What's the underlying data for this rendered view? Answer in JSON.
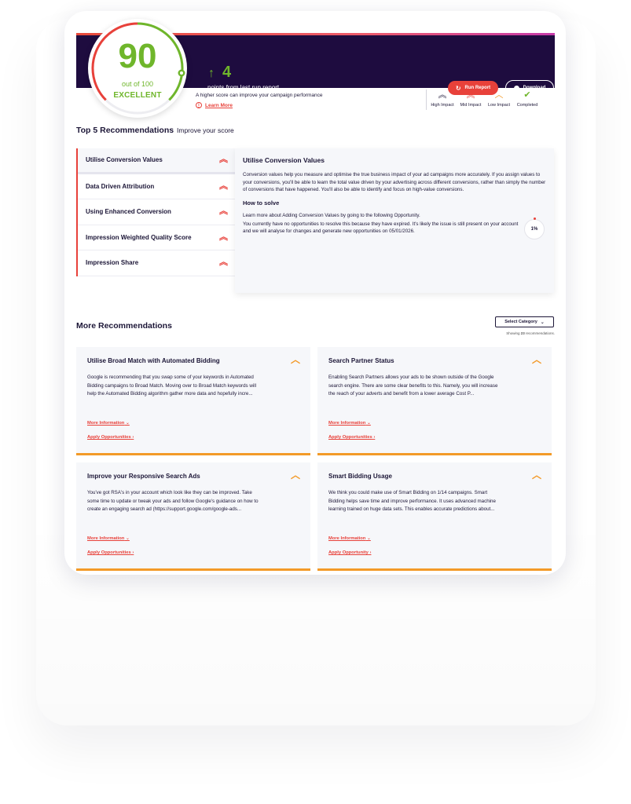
{
  "score": {
    "value": "90",
    "out_of": "out of 100",
    "grade": "EXCELLENT",
    "level_fraction": 0.9,
    "colors": {
      "good": "#6fb62b",
      "bad": "#e8413a"
    }
  },
  "delta": {
    "value": "4",
    "label": "points from last run report",
    "report_date": "Report last run 20/08/2023"
  },
  "header": {
    "run_report": "Run Report",
    "download": "Download",
    "background": "#1e0c3f"
  },
  "hint": {
    "text": "A higher score can improve your campaign performance",
    "learn_more": "Learn More"
  },
  "legend": [
    {
      "icon": "high-impact-icon",
      "label": "High Impact"
    },
    {
      "icon": "mid-impact-icon",
      "label": "Mid Impact"
    },
    {
      "icon": "low-impact-icon",
      "label": "Low Impact"
    },
    {
      "icon": "completed-icon",
      "label": "Completed"
    }
  ],
  "top5": {
    "title": "Top 5 Recommendations",
    "subtitle": "Improve your score",
    "items": [
      {
        "label": "Utilise Conversion Values"
      },
      {
        "label": "Data Driven Attribution"
      },
      {
        "label": "Using Enhanced Conversion"
      },
      {
        "label": "Impression Weighted Quality Score"
      },
      {
        "label": "Impression Share"
      }
    ],
    "detail": {
      "title": "Utilise Conversion Values",
      "body": "Conversion values help you measure and optimise the true business impact of your ad campaigns more accurately. If you assign values to your conversions, you'll be able to learn the total value driven by your advertising across different conversions, rather than simply the number of conversions that have happened. You'll also be able to identify and focus on high-value conversions.",
      "how_title": "How to solve",
      "learn_line": "Learn more about Adding Conversion Values by going to the following Opportunity.",
      "note": "You currently have no opportunities to resolve this because they have expired. It's likely the issue is still present on your account and we will analyse for changes and generate new opportunities on 05/01/2026.",
      "percent": "1%"
    }
  },
  "more": {
    "title": "More Recommendations",
    "select_category": "Select Category",
    "showing_prefix": "Showing ",
    "showing_count": "23",
    "showing_suffix": " recommendations.",
    "more_info_label": "More Information",
    "cards": [
      {
        "title": "Utilise Broad Match with Automated Bidding",
        "body": "Google is recommending that you swap some of your keywords in Automated Bidding campaigns to Broad Match. Moving over to Broad Match keywords will help the Automated Bidding algorithm gather more data and hopefully incre...",
        "apply": "Apply Opportunities"
      },
      {
        "title": "Search Partner Status",
        "body": "Enabling Search Partners allows your ads to be shown outside of the Google search engine. There are some clear benefits to this. Namely, you will increase the reach of your adverts and benefit from a lower average Cost P...",
        "apply": "Apply Opportunities"
      },
      {
        "title": "Improve your Responsive Search Ads",
        "body": "You've got RSA's in your account which look like they can be improved. Take some time to update or tweak your ads and follow Google's guidance on how to create an engaging search ad (https://support.google.com/google-ads...",
        "apply": "Apply Opportunities"
      },
      {
        "title": "Smart Bidding Usage",
        "body": "We think you could make use of Smart Bidding on 1/14 campaigns. Smart Bidding helps save time and improve performance. It uses advanced machine learning trained on huge data sets. This enables accurate predictions about...",
        "apply": "Apply Opportunity"
      }
    ]
  }
}
